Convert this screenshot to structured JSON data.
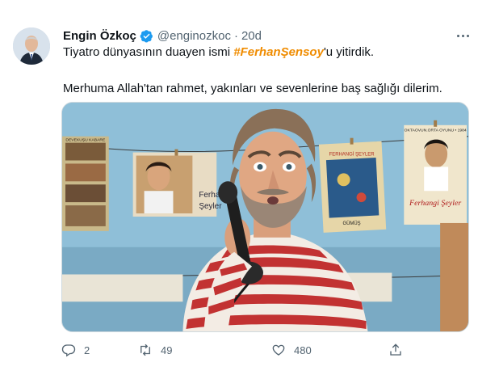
{
  "author": {
    "name": "Engin Özkoç",
    "handle": "@enginozkoc",
    "separator": "·",
    "time": "20d"
  },
  "tweet": {
    "line1_before": "Tiyatro dünyasının duayen ismi ",
    "hashtag": "#FerhanŞensoy",
    "line1_after": "'u yitirdik.",
    "line2": "Merhuma Allah'tan rahmet, yakınları ve sevenlerine baş sağlığı dilerim."
  },
  "media": {
    "poster_right_top": "OKTAOVUN.ORTA OYUNU • 1984",
    "poster_right_title": "Ferhangi Şeyler",
    "poster_mid_title": "FERHANGİ ŞEYLER",
    "poster_mid_sub": "GÜMÜŞ",
    "poster_left_title": "DEVEKUŞU KABARE",
    "poster_photo_text1": "Ferhan",
    "poster_photo_text2": "Şeyler"
  },
  "actions": {
    "reply_count": "2",
    "retweet_count": "49",
    "like_count": "480"
  },
  "colors": {
    "hashtag": "#f08c00",
    "verified": "#1d9bf0",
    "muted": "#536471"
  },
  "icons": {
    "verified": "verified-badge-icon",
    "more": "more-icon",
    "reply": "reply-icon",
    "retweet": "retweet-icon",
    "like": "heart-icon",
    "share": "share-icon"
  }
}
